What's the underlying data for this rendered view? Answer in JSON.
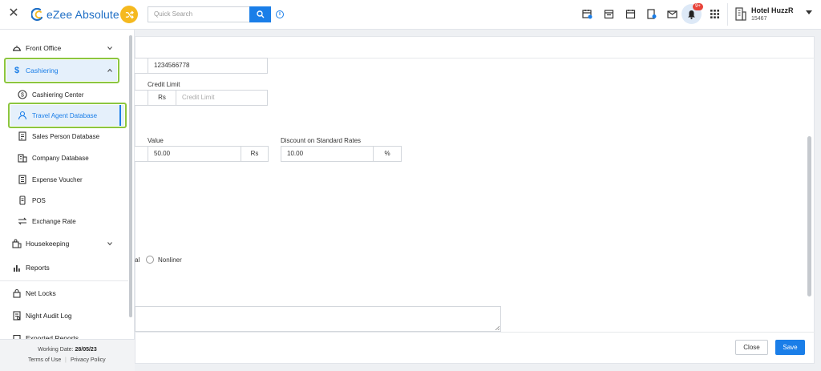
{
  "app": {
    "brand": "eZee Absolute",
    "search_placeholder": "Quick Search",
    "notification_count": "9+",
    "hotel_name": "Hotel HuzzR",
    "hotel_code": "15467",
    "accent": "#1a7ee8"
  },
  "sidebar": {
    "items": [
      {
        "label": "Front Office",
        "icon": "bell-desk-icon"
      },
      {
        "label": "Cashiering",
        "icon": "dollar-icon"
      },
      {
        "label": "Cashiering Center",
        "icon": "dollar-circle-icon"
      },
      {
        "label": "Travel Agent Database",
        "icon": "user-icon"
      },
      {
        "label": "Sales Person Database",
        "icon": "id-card-icon"
      },
      {
        "label": "Company Database",
        "icon": "building-icon"
      },
      {
        "label": "Expense Voucher",
        "icon": "voucher-icon"
      },
      {
        "label": "POS",
        "icon": "pos-icon"
      },
      {
        "label": "Exchange Rate",
        "icon": "exchange-icon"
      },
      {
        "label": "Housekeeping",
        "icon": "housekeeping-icon"
      },
      {
        "label": "Reports",
        "icon": "bar-chart-icon"
      },
      {
        "label": "Net Locks",
        "icon": "lock-icon"
      },
      {
        "label": "Night Audit Log",
        "icon": "log-icon"
      },
      {
        "label": "Exported Reports",
        "icon": "export-icon"
      }
    ],
    "working_date_label": "Working Date:",
    "working_date": "28/05/23",
    "terms": "Terms of Use",
    "privacy": "Privacy Policy"
  },
  "form": {
    "phone_value": "1234566778",
    "credit_limit_label": "Credit Limit",
    "credit_currency": "Rs",
    "credit_placeholder": "Credit Limit",
    "value_label": "Value",
    "value": "50.00",
    "value_unit": "Rs",
    "discount_label": "Discount on Standard Rates",
    "discount_value": "10.00",
    "discount_unit": "%",
    "radio_partial_label": "al",
    "radio_label": "Nonliner"
  },
  "footer": {
    "close_label": "Close",
    "save_label": "Save"
  }
}
